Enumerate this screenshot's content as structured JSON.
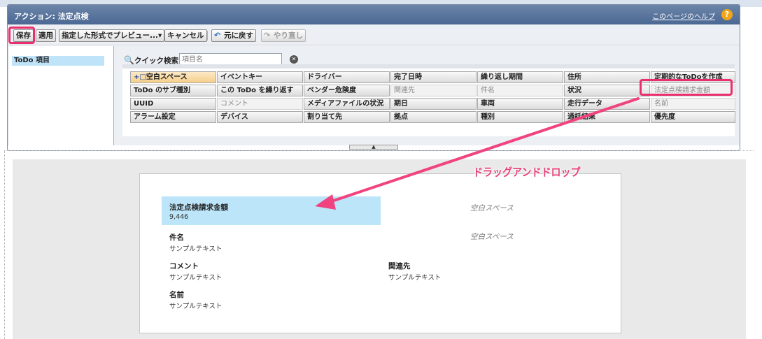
{
  "titlebar": {
    "title": "アクション: 法定点検",
    "help": "このページのヘルプ"
  },
  "toolbar": {
    "save": "保存",
    "apply": "適用",
    "preview": "指定した形式でプレビュー...▾",
    "cancel": "キャンセル",
    "undo": "元に戻す",
    "redo": "やり直し"
  },
  "sidebar": {
    "items": [
      {
        "label": "ToDo 項目"
      }
    ]
  },
  "search": {
    "label": "クイック検索",
    "placeholder": "項目名"
  },
  "palette": {
    "rows": [
      [
        "空白スペース",
        "イベントキー",
        "ドライバー",
        "完了日時",
        "繰り返し期間",
        "住所",
        "定期的なToDoを作成"
      ],
      [
        "ToDo のサブ種別",
        "この ToDo を繰り返す",
        "ベンダー危険度",
        "関連先",
        "件名",
        "状況",
        "法定点検請求金額"
      ],
      [
        "UUID",
        "コメント",
        "メディアファイルの状況",
        "期日",
        "車両",
        "走行データ",
        "名前"
      ],
      [
        "アラーム設定",
        "デバイス",
        "割り当て先",
        "拠点",
        "種別",
        "通話結果",
        "優先度"
      ]
    ]
  },
  "annotation": {
    "drag_drop": "ドラッグアンドドロップ"
  },
  "layout": {
    "fields": [
      {
        "label": "法定点検請求金額",
        "value": "9,446"
      },
      {
        "label": "件名",
        "value": "サンプルテキスト"
      },
      {
        "label": "コメント",
        "value": "サンプルテキスト"
      },
      {
        "label": "名前",
        "value": "サンプルテキスト"
      },
      {
        "label": "関連先",
        "value": "サンプルテキスト"
      }
    ],
    "blank1": "空白スペース",
    "blank2": "空白スペース"
  },
  "colors": {
    "highlight": "#ea2e6e",
    "selected": "#bde5f9",
    "titlebar": "#4b6894"
  }
}
